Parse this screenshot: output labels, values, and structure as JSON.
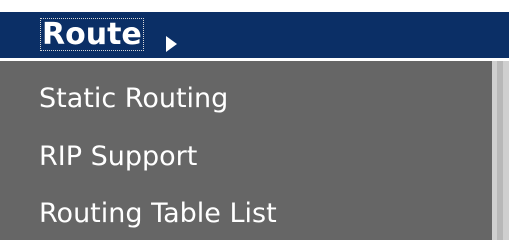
{
  "menu": {
    "title": "Route",
    "items": [
      {
        "label": "Static Routing"
      },
      {
        "label": "RIP Support"
      },
      {
        "label": "Routing Table List"
      }
    ],
    "icons": {
      "expand": "chevron-right-icon"
    },
    "colors": {
      "header_bg": "#0b2f66",
      "list_bg": "#666666",
      "text": "#ffffff",
      "scrollbar": "#cfcfcf"
    }
  }
}
